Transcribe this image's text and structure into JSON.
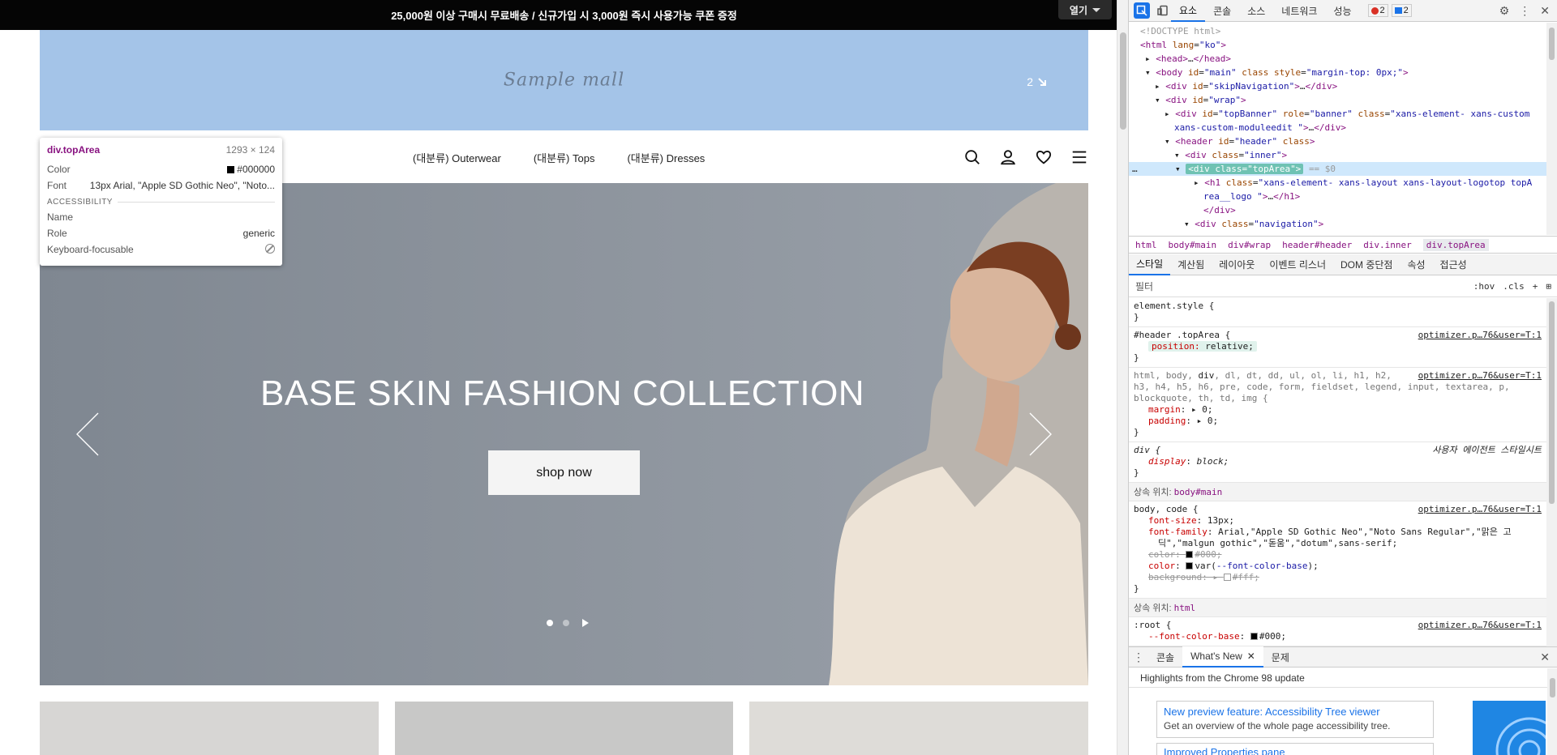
{
  "page": {
    "announcement": "25,000원 이상 구매시 무료배송 / 신규가입 시 3,000원 즉시 사용가능 쿠폰 증정",
    "open_button": "열기",
    "logo_text": "Sample mall",
    "banner_badge": "2",
    "nav": [
      "(대분류) Outerwear",
      "(대분류) Tops",
      "(대분류) Dresses"
    ],
    "hero_title": "BASE SKIN FASHION COLLECTION",
    "shop_button": "shop now",
    "slide_total": 2,
    "slide_current": 1
  },
  "tooltip": {
    "element": "div.topArea",
    "size": "1293 × 124",
    "color_label": "Color",
    "color_value": "#000000",
    "font_label": "Font",
    "font_value": "13px Arial, \"Apple SD Gothic Neo\", \"Noto...",
    "section": "ACCESSIBILITY",
    "name_label": "Name",
    "name_value": "",
    "role_label": "Role",
    "role_value": "generic",
    "kb_label": "Keyboard-focusable"
  },
  "devtools": {
    "tabs": [
      "요소",
      "콘솔",
      "소스",
      "네트워크",
      "성능"
    ],
    "errors": "2",
    "messages": "2",
    "breadcrumbs": [
      "html",
      "body#main",
      "div#wrap",
      "header#header",
      "div.inner",
      "div.topArea"
    ],
    "sub_tabs": [
      "스타일",
      "계산됨",
      "레이아웃",
      "이벤트 리스너",
      "DOM 중단점",
      "속성",
      "접근성"
    ],
    "filter_placeholder": "필터",
    "filter_opts": [
      ":hov",
      ".cls",
      "+"
    ],
    "src_link": "optimizer.p…76&user=T:1",
    "ua_label": "사용자 에이전트 스타일시트",
    "inherit_body": "상속 위치:",
    "inherit_body_from": "body#main",
    "inherit_html": "상속 위치:",
    "inherit_html_from": "html",
    "drawer_tabs": [
      "콘솔",
      "What's New",
      "문제"
    ],
    "drawer_heading": "Highlights from the Chrome 98 update",
    "news_title": "New preview feature: Accessibility Tree viewer",
    "news_desc": "Get an overview of the whole page accessibility tree.",
    "news2_title": "Improved Properties pane"
  }
}
